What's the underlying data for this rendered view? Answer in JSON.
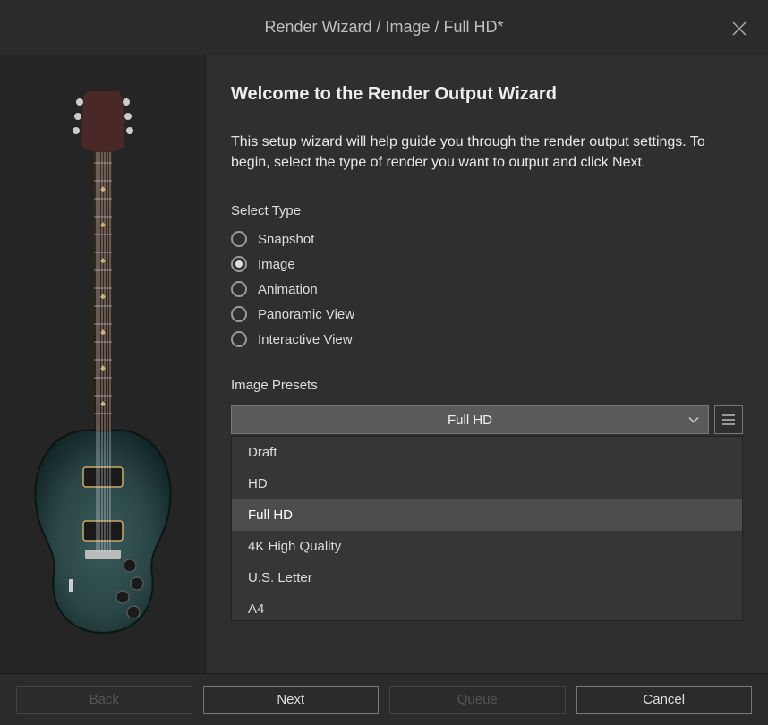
{
  "titlebar": {
    "title": "Render Wizard / Image / Full HD*"
  },
  "main": {
    "heading": "Welcome to the Render Output Wizard",
    "intro": "This setup wizard will help guide you through the render output settings. To begin, select the type of render you want to output and click Next.",
    "select_type_label": "Select Type",
    "types": [
      {
        "label": "Snapshot",
        "checked": false
      },
      {
        "label": "Image",
        "checked": true
      },
      {
        "label": "Animation",
        "checked": false
      },
      {
        "label": "Panoramic View",
        "checked": false
      },
      {
        "label": "Interactive View",
        "checked": false
      }
    ],
    "presets_label": "Image Presets",
    "preset_selected": "Full HD",
    "preset_options": [
      {
        "label": "Draft",
        "selected": false
      },
      {
        "label": "HD",
        "selected": false
      },
      {
        "label": "Full HD",
        "selected": true
      },
      {
        "label": "4K High Quality",
        "selected": false
      },
      {
        "label": "U.S. Letter",
        "selected": false
      },
      {
        "label": "A4",
        "selected": false
      }
    ]
  },
  "footer": {
    "back": "Back",
    "next": "Next",
    "queue": "Queue",
    "cancel": "Cancel"
  }
}
